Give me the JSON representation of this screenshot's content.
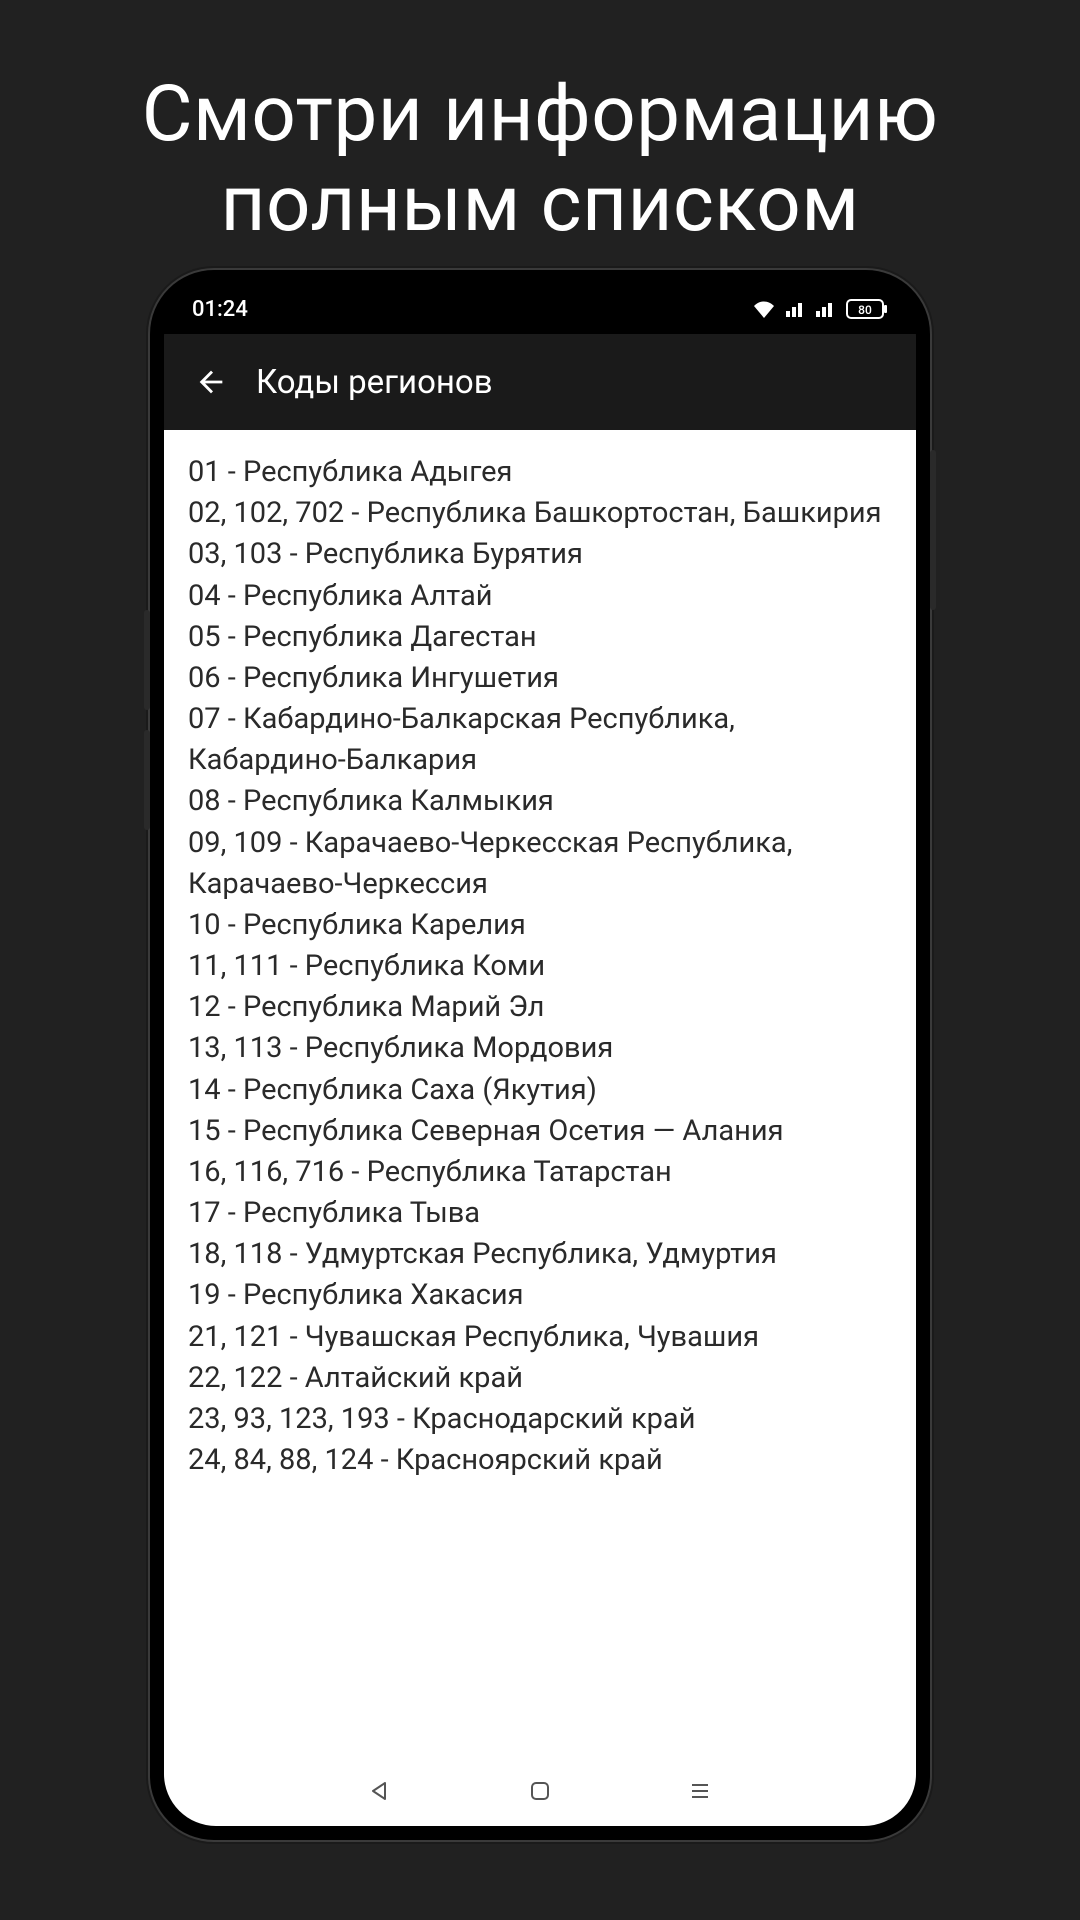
{
  "headline": {
    "line1": "Смотри информацию",
    "line2": "полным списком"
  },
  "status": {
    "time": "01:24",
    "battery": "80"
  },
  "appbar": {
    "title": "Коды регионов"
  },
  "regions": [
    "01 - Республика Адыгея",
    "02, 102, 702 - Республика Башкортостан, Башкирия",
    "03, 103 - Республика Бурятия",
    "04 - Республика Алтай",
    "05 - Республика Дагестан",
    "06 - Республика Ингушетия",
    "07 - Кабардино-Балкарская Республика, Кабардино-Балкария",
    "08 - Республика Калмыкия",
    "09, 109 - Карачаево-Черкесская Республика, Карачаево-Черкессия",
    "10 - Республика Карелия",
    "11, 111 - Республика Коми",
    "12 - Республика Марий Эл",
    "13, 113 - Республика Мордовия",
    "14 - Республика Саха (Якутия)",
    "15 - Республика Северная Осетия — Алания",
    "16, 116, 716 - Республика Татарстан",
    "17 - Республика Тыва",
    "18, 118 - Удмуртская Республика, Удмуртия",
    "19 - Республика Хакасия",
    "21, 121 - Чувашская Республика, Чувашия",
    "22, 122 - Алтайский край",
    "23, 93, 123, 193 - Краснодарский край",
    "24, 84, 88, 124 - Красноярский край"
  ]
}
